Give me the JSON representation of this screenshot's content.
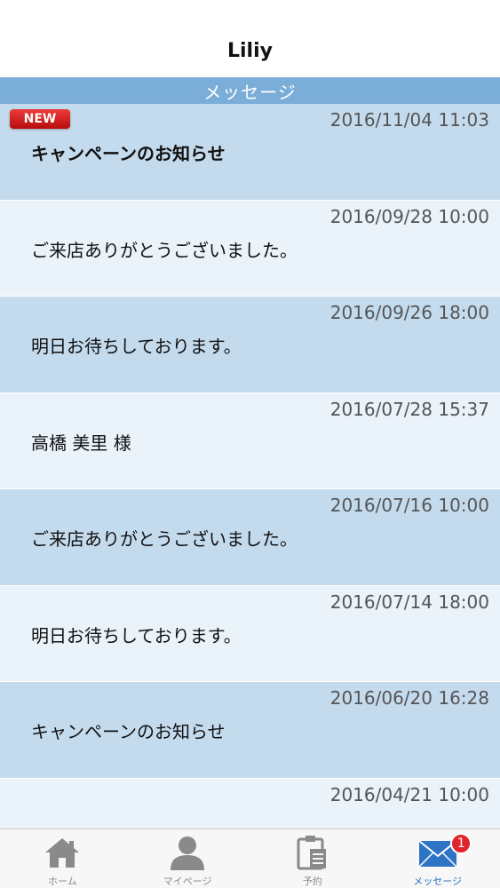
{
  "app": {
    "title": "Liliy"
  },
  "section": {
    "title": "メッセージ"
  },
  "badges": {
    "new_label": "NEW"
  },
  "messages": [
    {
      "date": "2016/11/04 11:03",
      "subject": "キャンペーンのお知らせ",
      "is_new": true
    },
    {
      "date": "2016/09/28 10:00",
      "subject": "ご来店ありがとうございました。",
      "is_new": false
    },
    {
      "date": "2016/09/26 18:00",
      "subject": "明日お待ちしております。",
      "is_new": false
    },
    {
      "date": "2016/07/28 15:37",
      "subject": "高橋 美里 様",
      "is_new": false
    },
    {
      "date": "2016/07/16 10:00",
      "subject": "ご来店ありがとうございました。",
      "is_new": false
    },
    {
      "date": "2016/07/14 18:00",
      "subject": "明日お待ちしております。",
      "is_new": false
    },
    {
      "date": "2016/06/20 16:28",
      "subject": "キャンペーンのお知らせ",
      "is_new": false
    },
    {
      "date": "2016/04/21 10:00",
      "subject": "",
      "is_new": false
    }
  ],
  "tabs": [
    {
      "label": "ホーム",
      "icon": "home-icon"
    },
    {
      "label": "マイページ",
      "icon": "person-icon"
    },
    {
      "label": "予約",
      "icon": "clipboard-icon"
    },
    {
      "label": "メッセージ",
      "icon": "mail-icon",
      "badge": "1",
      "active": true
    }
  ],
  "colors": {
    "header": "#7badd9",
    "row_dark": "#c4dbee",
    "row_light": "#eaf2fa",
    "tab_active": "#2d74c4",
    "badge_red": "#e0262c"
  }
}
